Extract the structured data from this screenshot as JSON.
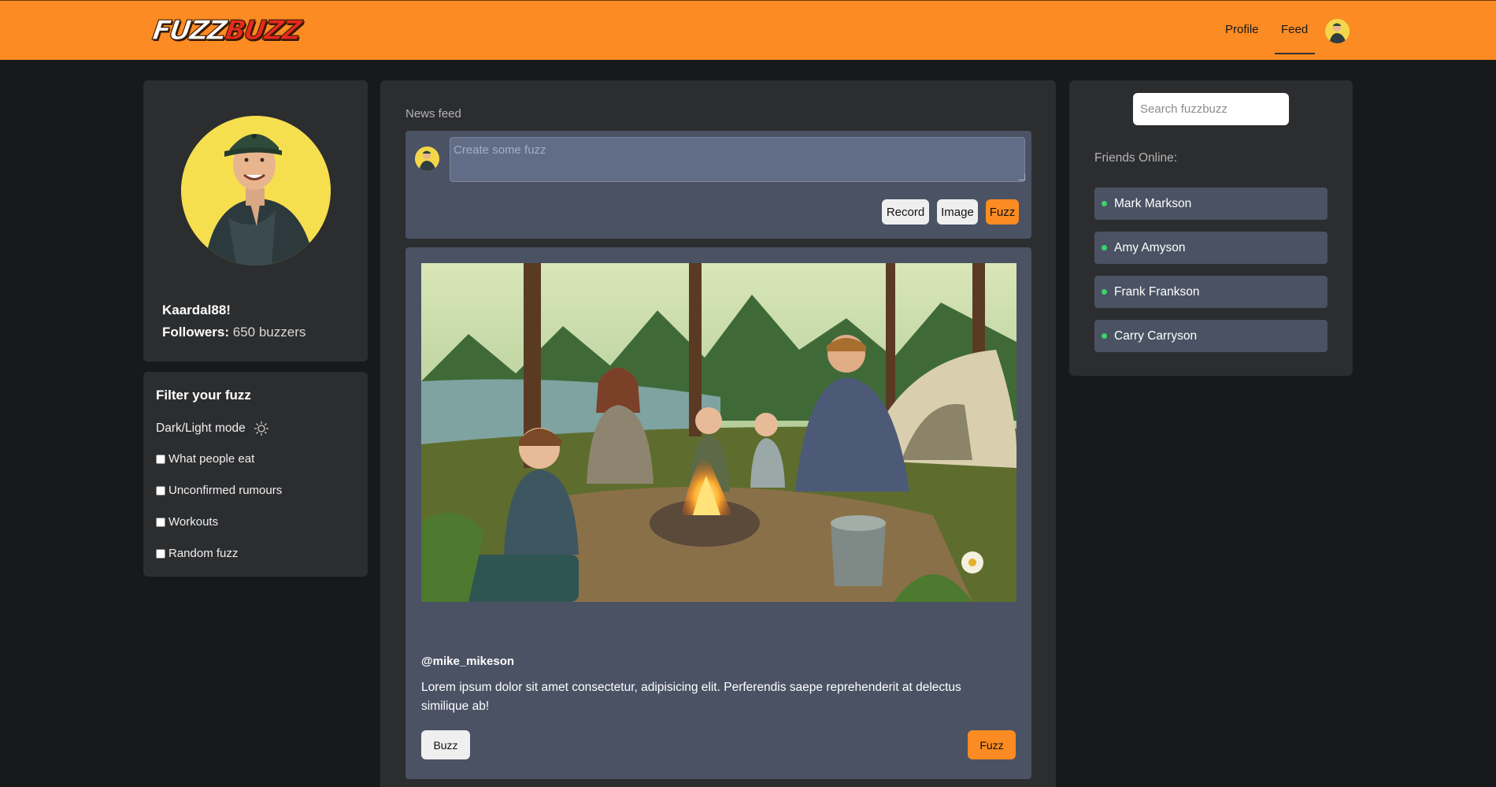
{
  "brand": {
    "logo_part1": "FUZZ",
    "logo_part2": "BUZZ",
    "accent": "#fb8b22"
  },
  "nav": {
    "profile_label": "Profile",
    "feed_label": "Feed",
    "active": "Feed",
    "avatar_icon": "user-avatar"
  },
  "profile": {
    "username": "Kaardal88!",
    "followers_label": "Followers:",
    "followers_value": "650 buzzers"
  },
  "filter": {
    "title": "Filter your fuzz",
    "mode_label": "Dark/Light mode",
    "mode_icon": "sun-icon",
    "options": [
      {
        "label": "What people eat",
        "checked": false
      },
      {
        "label": "Unconfirmed rumours",
        "checked": false
      },
      {
        "label": "Workouts",
        "checked": false
      },
      {
        "label": "Random fuzz",
        "checked": false
      }
    ]
  },
  "feed": {
    "label": "News feed",
    "composer": {
      "placeholder": "Create some fuzz",
      "record": "Record",
      "image": "Image",
      "fuzz": "Fuzz"
    },
    "posts": [
      {
        "image": "family-campfire-photo",
        "user": "@mike_mikeson",
        "text": "Lorem ipsum dolor sit amet consectetur, adipisicing elit. Perferendis saepe reprehenderit at delectus similique ab!",
        "buzz_label": "Buzz",
        "fuzz_label": "Fuzz"
      }
    ]
  },
  "sidebar": {
    "search_placeholder": "Search fuzzbuzz",
    "friends_label": "Friends Online:",
    "friends": [
      "Mark Markson",
      "Amy Amyson",
      "Frank Frankson",
      "Carry Carryson"
    ],
    "online_color": "#3ad36c"
  }
}
